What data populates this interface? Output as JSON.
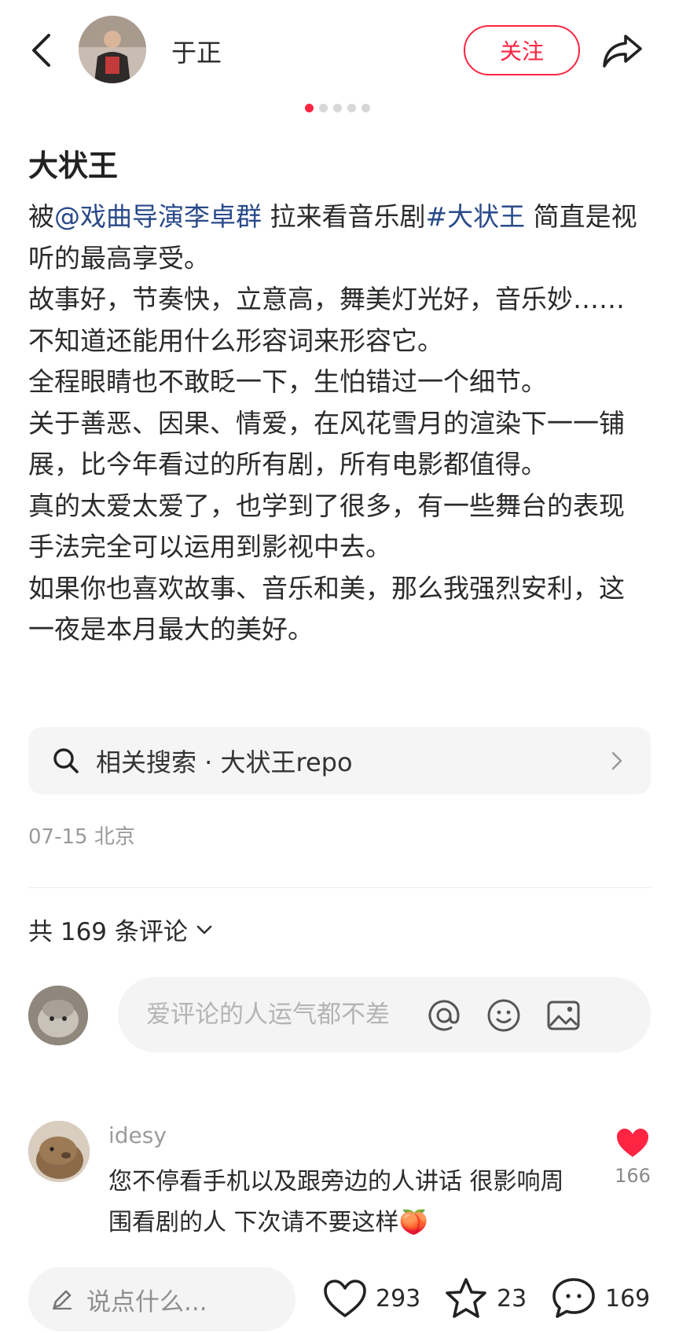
{
  "header": {
    "author_name": "于正",
    "follow_label": "关注",
    "image_dots_count": 5
  },
  "post": {
    "title": "大状王",
    "body": {
      "mention": "@戏曲导演李卓群",
      "after_mention": " 拉来看音乐剧",
      "tag": "#大状王",
      "after_tag": " 简直是视听的最高享受。",
      "lines": [
        "故事好，节奏快，立意高，舞美灯光好，音乐妙……不知道还能用什么形容词来形容它。",
        "全程眼睛也不敢眨一下，生怕错过一个细节。",
        "关于善恶、因果、情爱，在风花雪月的渲染下一一铺展，比今年看过的所有剧，所有电影都值得。",
        "真的太爱太爱了，也学到了很多，有一些舞台的表现手法完全可以运用到影视中去。",
        "如果你也喜欢故事、音乐和美，那么我强烈安利，这一夜是本月最大的美好。"
      ]
    },
    "body_prefix": "被",
    "related_search": "相关搜索 · 大状王repo",
    "meta": "07-15 北京"
  },
  "comments": {
    "count_label": "共 169 条评论",
    "input_placeholder": "爱评论的人运气都不差",
    "items": [
      {
        "user": "idesy",
        "text": "您不停看手机以及跟旁边的人讲话 很影响周围看剧的人 下次请不要这样",
        "emoji": "🍑",
        "likes": "166"
      }
    ]
  },
  "bottom_bar": {
    "say_placeholder": "说点什么...",
    "likes": "293",
    "favorites": "23",
    "comments": "169"
  },
  "colors": {
    "accent": "#ff2442",
    "link": "#2a4a8a",
    "muted": "#9a9a9a"
  }
}
